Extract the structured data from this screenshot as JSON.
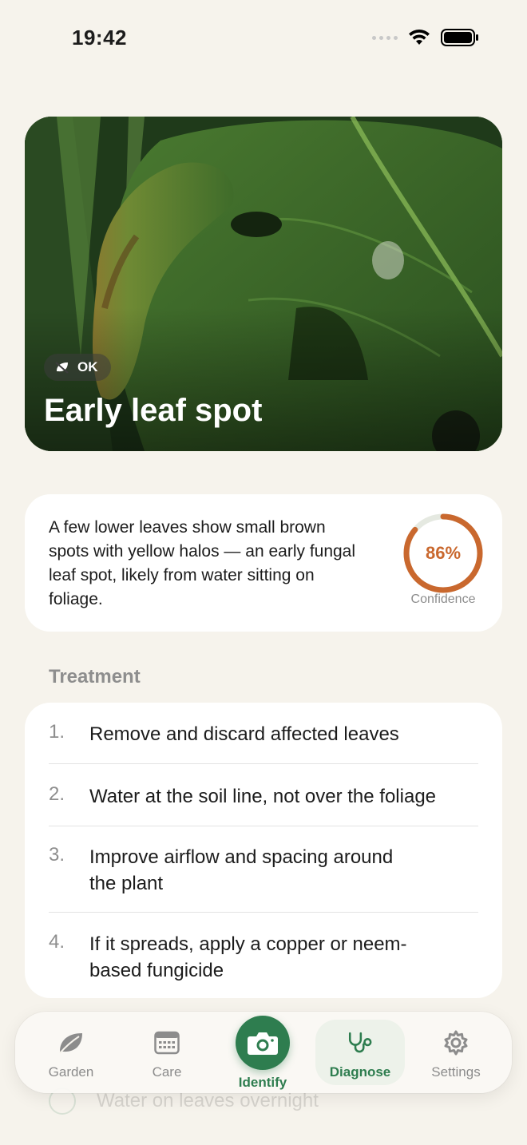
{
  "status_bar": {
    "time": "19:42"
  },
  "hero": {
    "status_badge": "OK",
    "title": "Early leaf spot"
  },
  "diagnosis": {
    "description": "A few lower leaves show small brown spots with yellow halos — an early fungal leaf spot, likely from water sitting on foliage.",
    "confidence": {
      "value": 0.86,
      "display": "86%",
      "label": "Confidence"
    }
  },
  "treatment": {
    "title": "Treatment",
    "steps": [
      {
        "num": "1.",
        "text": "Remove and discard affected leaves"
      },
      {
        "num": "2.",
        "text": "Water at the soil line, not over the foliage"
      },
      {
        "num": "3.",
        "text": "Improve airflow and spacing around the plant"
      },
      {
        "num": "4.",
        "text": "If it spreads, apply a copper or neem-based fungicide"
      }
    ]
  },
  "ghost_item": {
    "text": "Water on leaves overnight"
  },
  "tabbar": {
    "tabs": [
      {
        "label": "Garden",
        "icon": "leaf-icon"
      },
      {
        "label": "Care",
        "icon": "calendar-icon"
      },
      {
        "label": "Identify",
        "icon": "camera-icon"
      },
      {
        "label": "Diagnose",
        "icon": "stethoscope-icon",
        "active": true
      },
      {
        "label": "Settings",
        "icon": "gear-icon"
      }
    ]
  },
  "colors": {
    "accent": "#2e7d4f",
    "confidence": "#c9682e",
    "background": "#f6f3ec"
  }
}
